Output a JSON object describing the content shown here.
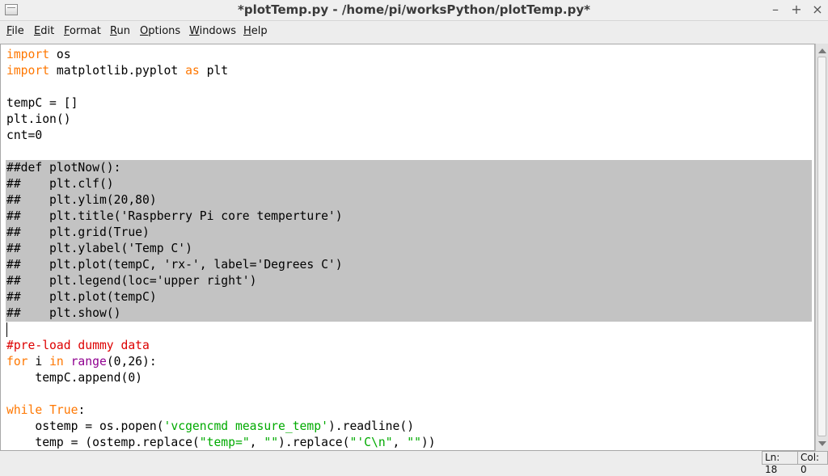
{
  "window": {
    "title": "*plotTemp.py - /home/pi/worksPython/plotTemp.py*"
  },
  "window_controls": {
    "minimize": "–",
    "maximize": "+",
    "close": "×"
  },
  "menu": [
    {
      "label": "File",
      "mnemonic": "F",
      "rest": "ile"
    },
    {
      "label": "Edit",
      "mnemonic": "E",
      "rest": "dit"
    },
    {
      "label": "Format",
      "mnemonic": "F",
      "rest": "ormat"
    },
    {
      "label": "Run",
      "mnemonic": "R",
      "rest": "un"
    },
    {
      "label": "Options",
      "mnemonic": "O",
      "rest": "ptions"
    },
    {
      "label": "Windows",
      "mnemonic": "W",
      "rest": "indows"
    },
    {
      "label": "Help",
      "mnemonic": "H",
      "rest": "elp"
    }
  ],
  "code": {
    "l1_kw": "import",
    "l1_rest": " os",
    "l2_kw": "import",
    "l2_mid": " matplotlib.pyplot ",
    "l2_kw2": "as",
    "l2_rest": " plt",
    "l4": "tempC = []",
    "l5": "plt.ion()",
    "l6": "cnt=0",
    "l8": "##def plotNow():",
    "l9": "##    plt.clf()",
    "l10": "##    plt.ylim(20,80)",
    "l11": "##    plt.title('Raspberry Pi core temperture')",
    "l12": "##    plt.grid(True)",
    "l13": "##    plt.ylabel('Temp C')",
    "l14": "##    plt.plot(tempC, 'rx-', label='Degrees C')",
    "l15": "##    plt.legend(loc='upper right')",
    "l16": "##    plt.plot(tempC)",
    "l17": "##    plt.show()",
    "l19": "#pre-load dummy data",
    "l20_kw1": "for",
    "l20_a": " i ",
    "l20_kw2": "in",
    "l20_sp": " ",
    "l20_bi": "range",
    "l20_rest": "(0,26):",
    "l21": "    tempC.append(0)",
    "l23_kw": "while",
    "l23_sp": " ",
    "l23_kw2": "True",
    "l23_rest": ":",
    "l24_a": "    ostemp = os.popen(",
    "l24_str": "'vcgencmd measure_temp'",
    "l24_rest": ").readline()",
    "l25_a": "    temp = (ostemp.replace(",
    "l25_s1": "\"temp=\"",
    "l25_b": ", ",
    "l25_s2": "\"\"",
    "l25_c": ").replace(",
    "l25_s3": "\"'C\\n\"",
    "l25_d": ", ",
    "l25_s4": "\"\"",
    "l25_e": "))"
  },
  "status": {
    "line": "Ln: 18",
    "col": "Col: 0"
  },
  "colors": {
    "keyword": "#ff7700",
    "builtin": "#900090",
    "string": "#00aa00",
    "comment": "#dd0000",
    "selection": "#c3c3c3"
  }
}
